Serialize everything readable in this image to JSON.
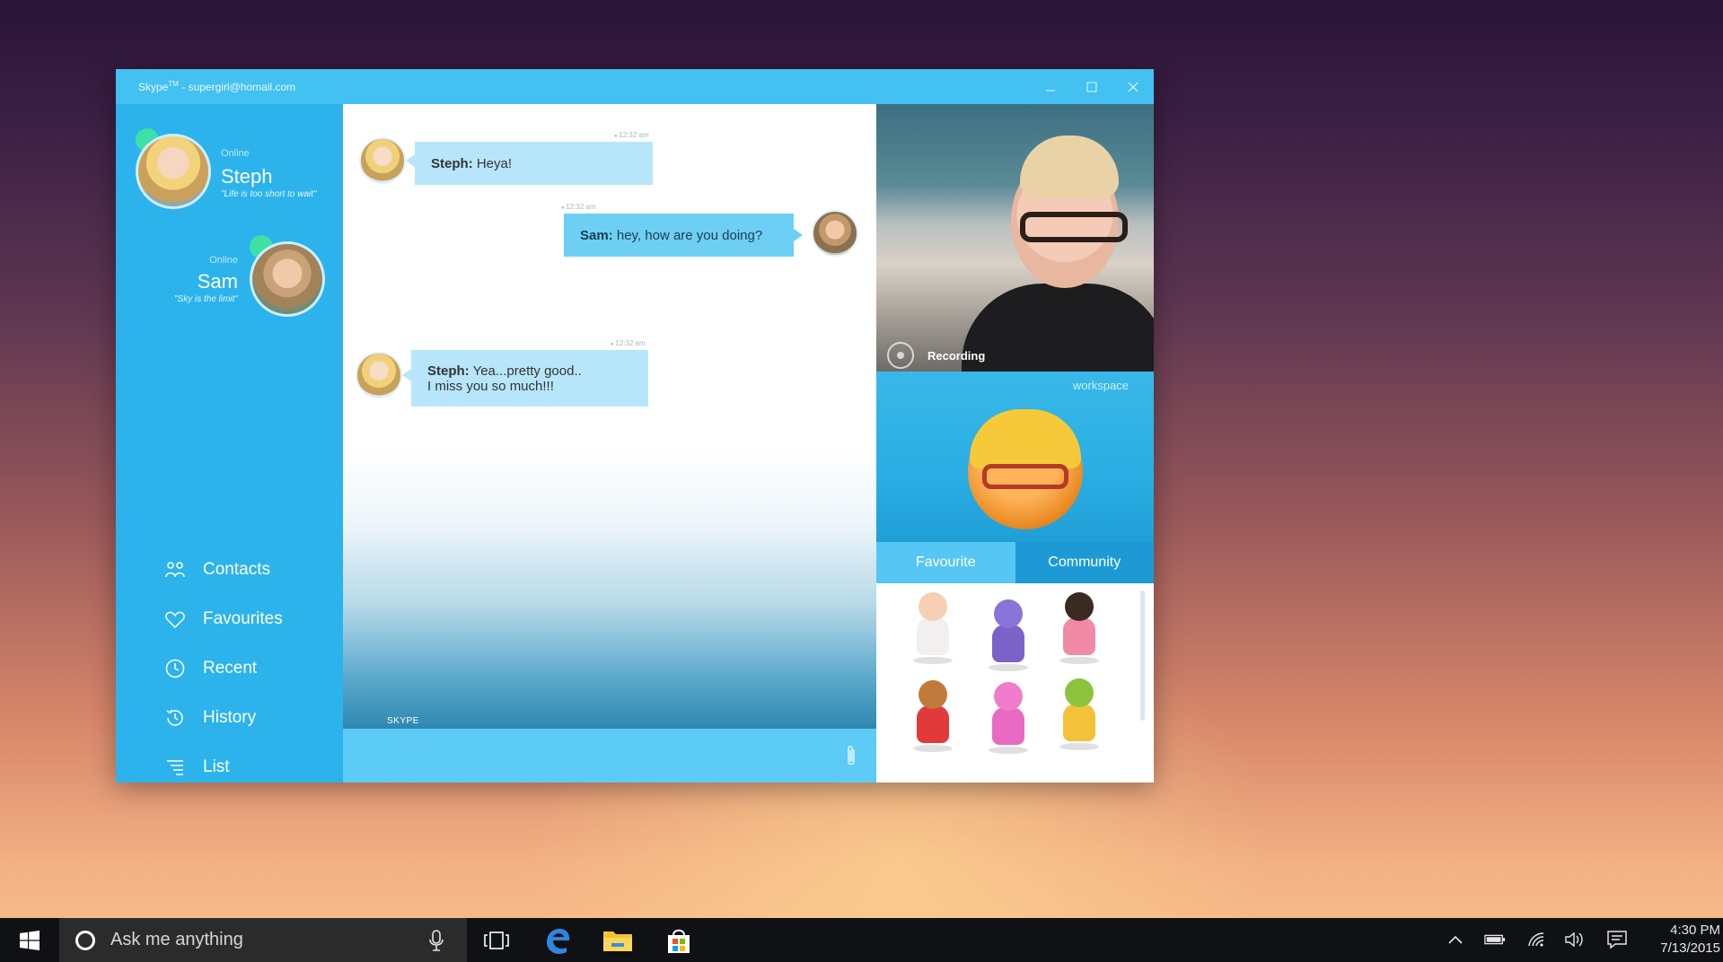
{
  "window": {
    "title": "Skype",
    "title_sup": "TM",
    "account": "- supergirl@homail.com"
  },
  "contacts": [
    {
      "name": "Steph",
      "status": "Online",
      "mood": "\"Life is too short to wait\""
    },
    {
      "name": "Sam",
      "status": "Online",
      "mood": "\"Sky is the limit\""
    }
  ],
  "nav": {
    "contacts": "Contacts",
    "favourites": "Favourites",
    "recent": "Recent",
    "history": "History",
    "list": "List"
  },
  "messages": [
    {
      "sender": "Steph:",
      "text": "Heya!",
      "time": "12:32 am"
    },
    {
      "sender": "Sam:",
      "text": "hey, how are you doing?",
      "time": "12:32 am"
    },
    {
      "sender": "Steph:",
      "text": "Yea...pretty good..",
      "text2": "I miss you so much!!!",
      "time": "12:32 am"
    }
  ],
  "chat": {
    "brand": "SKYPE"
  },
  "video": {
    "recording": "Recording"
  },
  "workspace": {
    "label": "workspace"
  },
  "tabs": {
    "favourite": "Favourite",
    "community": "Community"
  },
  "taskbar": {
    "search_placeholder": "Ask me anything",
    "time": "4:30 PM",
    "date": "7/13/2015"
  },
  "colors": {
    "skype_blue": "#2cb3ec",
    "title_bar": "#43c1f1",
    "bubble_in": "#b7e6fb",
    "bubble_out": "#6ecff5",
    "presence": "#3fe0a6"
  }
}
